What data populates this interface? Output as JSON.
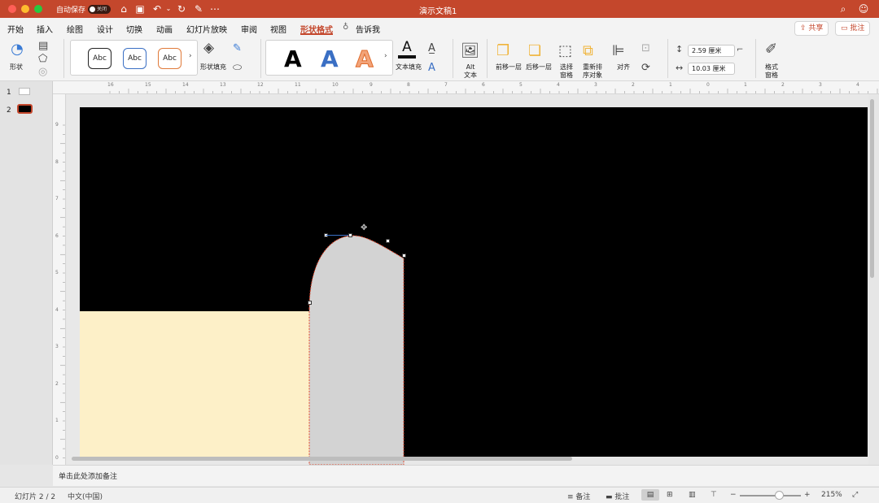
{
  "window": {
    "title": "演示文稿1",
    "autosave_label": "自动保存",
    "autosave_state": "关闭",
    "traffic_colors": [
      "#ff5f57",
      "#febc2e",
      "#28c840"
    ]
  },
  "tabs": [
    {
      "label": "开始"
    },
    {
      "label": "插入"
    },
    {
      "label": "绘图"
    },
    {
      "label": "设计"
    },
    {
      "label": "切换"
    },
    {
      "label": "动画"
    },
    {
      "label": "幻灯片放映"
    },
    {
      "label": "审阅"
    },
    {
      "label": "视图"
    },
    {
      "label": "形状格式"
    },
    {
      "label": "告诉我"
    }
  ],
  "active_tab": "形状格式",
  "header_buttons": {
    "share": "共享",
    "comment": "批注"
  },
  "ribbon": {
    "shape_label": "形状",
    "abc_samples": [
      "Abc",
      "Abc",
      "Abc"
    ],
    "shape_fill_label": "形状填充",
    "wordart_samples": [
      "A",
      "A",
      "A"
    ],
    "text_fill_label": "文本填充",
    "alt_text_label": "Alt\n文本",
    "bring_forward_label": "前移一层",
    "send_backward_label": "后移一层",
    "selection_pane_label": "选择\n窗格",
    "reorder_label": "重新排\n序对象",
    "align_label": "对齐",
    "height_value": "2.59 厘米",
    "width_value": "10.03 厘米",
    "format_pane_label": "格式\n窗格"
  },
  "ruler": {
    "h_labels": [
      "16",
      "15",
      "14",
      "13",
      "12",
      "11",
      "10",
      "9",
      "8",
      "7",
      "6",
      "5",
      "4",
      "3",
      "2",
      "1",
      "0",
      "1",
      "2",
      "3",
      "4"
    ],
    "v_labels": [
      "9",
      "8",
      "7",
      "6",
      "5",
      "4",
      "3",
      "2",
      "1",
      "0"
    ]
  },
  "slides": [
    {
      "number": "1"
    },
    {
      "number": "2"
    }
  ],
  "notes_placeholder": "单击此处添加备注",
  "status": {
    "slide_counter": "幻灯片 2 / 2",
    "language": "中文(中国)",
    "notes_label": "备注",
    "comments_label": "批注",
    "zoom": "215%"
  },
  "colors": {
    "accent": "#c4472c",
    "slide_bg": "#000000",
    "cream_rect": "#fdf0c8",
    "shape_fill": "#d3d3d3",
    "shape_outline": "#e0442a"
  }
}
